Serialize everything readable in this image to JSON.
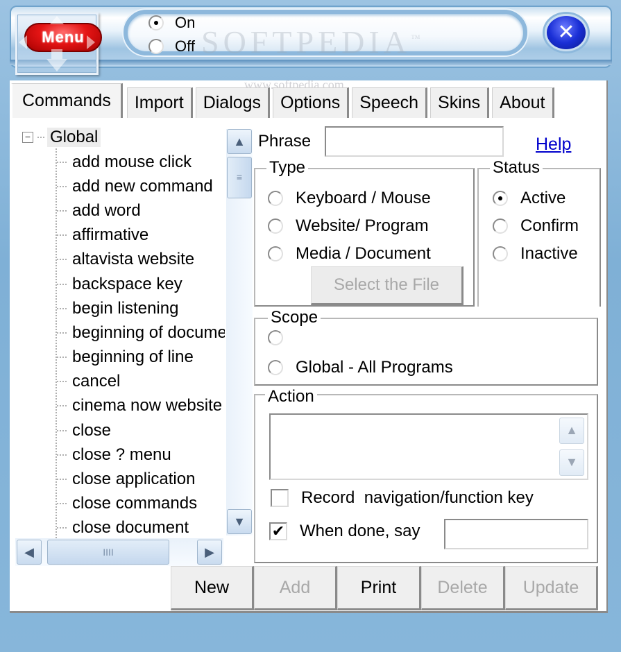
{
  "app": {
    "menu_label": "Menu",
    "power": {
      "options": [
        {
          "label": "On",
          "checked": true
        },
        {
          "label": "Off",
          "checked": false
        }
      ]
    },
    "close_icon": "close-x-icon",
    "watermark": "SOFTPEDIA",
    "watermark_tm": "™",
    "watermark_url": "www.softpedia.com"
  },
  "tabs": [
    {
      "label": "Commands",
      "active": true
    },
    {
      "label": "Import",
      "active": false
    },
    {
      "label": "Dialogs",
      "active": false
    },
    {
      "label": "Options",
      "active": false
    },
    {
      "label": "Speech",
      "active": false
    },
    {
      "label": "Skins",
      "active": false
    },
    {
      "label": "About",
      "active": false
    }
  ],
  "tree": {
    "root": {
      "label": "Global",
      "expander": "−"
    },
    "items": [
      "add mouse click",
      "add new command",
      "add word",
      "affirmative",
      "altavista website",
      "backspace key",
      "begin listening",
      "beginning of document",
      "beginning of line",
      "cancel",
      "cinema now website",
      "close",
      "close ? menu",
      "close application",
      "close commands",
      "close document"
    ],
    "scroll": {
      "up_icon": "^",
      "down_icon": "v",
      "left_icon": "<",
      "right_icon": ">",
      "thumb_grip": "≡",
      "hthumb_grip": "IIII"
    }
  },
  "form": {
    "phrase_label": "Phrase",
    "phrase_value": "",
    "help_link": "Help",
    "type": {
      "title": "Type",
      "options": [
        {
          "label": "Keyboard / Mouse",
          "checked": false
        },
        {
          "label": "Website/ Program",
          "checked": false
        },
        {
          "label": "Media / Document",
          "checked": false
        }
      ],
      "select_file_label": "Select the File"
    },
    "status": {
      "title": "Status",
      "options": [
        {
          "label": "Active",
          "checked": true
        },
        {
          "label": "Confirm",
          "checked": false
        },
        {
          "label": "Inactive",
          "checked": false
        }
      ]
    },
    "scope": {
      "title": "Scope",
      "options": [
        {
          "label": "",
          "checked": false
        },
        {
          "label": "Global - All Programs",
          "checked": false
        }
      ]
    },
    "action": {
      "title": "Action",
      "value": "",
      "record_label": "Record  navigation/function key",
      "record_checked": false,
      "when_done_label": "When done, say",
      "when_done_checked": true,
      "when_done_value": "",
      "check_mark": "✔"
    }
  },
  "buttons": [
    {
      "label": "New",
      "enabled": true
    },
    {
      "label": "Add",
      "enabled": false
    },
    {
      "label": "Print",
      "enabled": true
    },
    {
      "label": "Delete",
      "enabled": false
    },
    {
      "label": "Update",
      "enabled": false
    }
  ]
}
